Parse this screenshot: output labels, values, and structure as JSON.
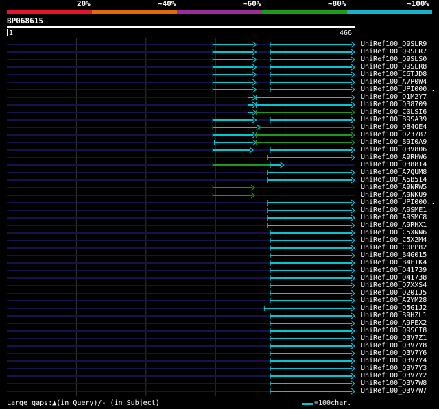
{
  "legend": {
    "colors": [
      "#e8142c",
      "#e06b0f",
      "#9b2e9b",
      "#1c9a1c",
      "#14b4c8"
    ],
    "labels": [
      "20%",
      "~40%",
      "~60%",
      "~80%",
      "~100%"
    ]
  },
  "query": {
    "name": "BP068615",
    "start": "1",
    "end": "466",
    "length": 466
  },
  "colors": {
    "background": "#000000",
    "track": "#14144b",
    "hit_cyan": "#00c8d2",
    "hit_green": "#1c9a1c",
    "grid": "#333333"
  },
  "hits": [
    {
      "name": "UniRef100_Q9SLR9",
      "segments": [
        {
          "start": 276,
          "end": 334,
          "color": "cyan"
        },
        {
          "start": 353,
          "end": 466,
          "color": "cyan"
        }
      ]
    },
    {
      "name": "UniRef100_Q9SLR7",
      "segments": [
        {
          "start": 276,
          "end": 334,
          "color": "cyan"
        },
        {
          "start": 353,
          "end": 466,
          "color": "cyan"
        }
      ]
    },
    {
      "name": "UniRef100_Q9SLS0",
      "segments": [
        {
          "start": 276,
          "end": 334,
          "color": "cyan"
        },
        {
          "start": 353,
          "end": 466,
          "color": "cyan"
        }
      ]
    },
    {
      "name": "UniRef100_Q9SLR8",
      "segments": [
        {
          "start": 276,
          "end": 334,
          "color": "cyan"
        },
        {
          "start": 353,
          "end": 466,
          "color": "cyan"
        }
      ]
    },
    {
      "name": "UniRef100_C6TJD8",
      "segments": [
        {
          "start": 276,
          "end": 334,
          "color": "cyan"
        },
        {
          "start": 353,
          "end": 466,
          "color": "cyan"
        }
      ]
    },
    {
      "name": "UniRef100_A7P0W4",
      "segments": [
        {
          "start": 276,
          "end": 334,
          "color": "cyan"
        },
        {
          "start": 353,
          "end": 466,
          "color": "cyan"
        }
      ]
    },
    {
      "name": "UniRef100_UPI000..",
      "segments": [
        {
          "start": 276,
          "end": 334,
          "color": "cyan"
        },
        {
          "start": 353,
          "end": 466,
          "color": "cyan"
        }
      ]
    },
    {
      "name": "UniRef100_Q1M2Y7",
      "segments": [
        {
          "start": 323,
          "end": 334,
          "color": "cyan"
        },
        {
          "start": 334,
          "end": 466,
          "color": "cyan"
        }
      ]
    },
    {
      "name": "UniRef100_Q38709",
      "segments": [
        {
          "start": 323,
          "end": 334,
          "color": "cyan"
        },
        {
          "start": 334,
          "end": 466,
          "color": "cyan"
        }
      ]
    },
    {
      "name": "UniRef100_C0LSI6",
      "segments": [
        {
          "start": 323,
          "end": 334,
          "color": "cyan"
        },
        {
          "start": 334,
          "end": 466,
          "color": "green"
        }
      ]
    },
    {
      "name": "UniRef100_B9SA39",
      "segments": [
        {
          "start": 276,
          "end": 334,
          "color": "cyan"
        },
        {
          "start": 353,
          "end": 466,
          "color": "cyan"
        }
      ]
    },
    {
      "name": "UniRef100_Q84QE4",
      "segments": [
        {
          "start": 276,
          "end": 339,
          "color": "cyan"
        },
        {
          "start": 339,
          "end": 466,
          "color": "green"
        }
      ]
    },
    {
      "name": "UniRef100_O23787",
      "segments": [
        {
          "start": 276,
          "end": 334,
          "color": "cyan"
        },
        {
          "start": 334,
          "end": 466,
          "color": "green"
        }
      ]
    },
    {
      "name": "UniRef100_B9I0A9",
      "segments": [
        {
          "start": 278,
          "end": 334,
          "color": "cyan"
        },
        {
          "start": 334,
          "end": 466,
          "color": "green"
        }
      ]
    },
    {
      "name": "UniRef100_Q3V806",
      "segments": [
        {
          "start": 276,
          "end": 330,
          "color": "cyan"
        },
        {
          "start": 353,
          "end": 466,
          "color": "cyan"
        }
      ]
    },
    {
      "name": "UniRef100_A9RHW6",
      "segments": [
        {
          "start": 349,
          "end": 466,
          "color": "cyan"
        }
      ]
    },
    {
      "name": "UniRef100_Q38814",
      "segments": [
        {
          "start": 276,
          "end": 371,
          "color": "green"
        },
        {
          "start": 353,
          "end": 371,
          "color": "cyan"
        }
      ]
    },
    {
      "name": "UniRef100_A7QUM8",
      "segments": [
        {
          "start": 349,
          "end": 466,
          "color": "cyan"
        }
      ]
    },
    {
      "name": "UniRef100_A5B514",
      "segments": [
        {
          "start": 349,
          "end": 466,
          "color": "cyan"
        }
      ]
    },
    {
      "name": "UniRef100_A9NRW5",
      "segments": [
        {
          "start": 276,
          "end": 332,
          "color": "green"
        }
      ]
    },
    {
      "name": "UniRef100_A9NKU9",
      "segments": [
        {
          "start": 276,
          "end": 332,
          "color": "green"
        }
      ]
    },
    {
      "name": "UniRef100_UPI000..",
      "segments": [
        {
          "start": 349,
          "end": 466,
          "color": "cyan"
        }
      ]
    },
    {
      "name": "UniRef100_A9SME1",
      "segments": [
        {
          "start": 349,
          "end": 466,
          "color": "cyan"
        }
      ]
    },
    {
      "name": "UniRef100_A9SMC8",
      "segments": [
        {
          "start": 349,
          "end": 466,
          "color": "cyan"
        }
      ]
    },
    {
      "name": "UniRef100_A9RHX1",
      "segments": [
        {
          "start": 349,
          "end": 466,
          "color": "cyan"
        }
      ]
    },
    {
      "name": "UniRef100_C5XNN6",
      "segments": [
        {
          "start": 353,
          "end": 466,
          "color": "cyan"
        }
      ]
    },
    {
      "name": "UniRef100_C5X2M4",
      "segments": [
        {
          "start": 353,
          "end": 466,
          "color": "cyan"
        }
      ]
    },
    {
      "name": "UniRef100_C0PP82",
      "segments": [
        {
          "start": 353,
          "end": 466,
          "color": "cyan"
        }
      ]
    },
    {
      "name": "UniRef100_B4G015",
      "segments": [
        {
          "start": 353,
          "end": 466,
          "color": "cyan"
        }
      ]
    },
    {
      "name": "UniRef100_B4FTK4",
      "segments": [
        {
          "start": 353,
          "end": 466,
          "color": "cyan"
        }
      ]
    },
    {
      "name": "UniRef100_O41739",
      "segments": [
        {
          "start": 353,
          "end": 466,
          "color": "cyan"
        }
      ]
    },
    {
      "name": "UniRef100_O41738",
      "segments": [
        {
          "start": 353,
          "end": 466,
          "color": "cyan"
        }
      ]
    },
    {
      "name": "UniRef100_Q7XXS4",
      "segments": [
        {
          "start": 353,
          "end": 466,
          "color": "cyan"
        }
      ]
    },
    {
      "name": "UniRef100_Q20IJ5",
      "segments": [
        {
          "start": 353,
          "end": 466,
          "color": "cyan"
        }
      ]
    },
    {
      "name": "UniRef100_A2YM28",
      "segments": [
        {
          "start": 353,
          "end": 466,
          "color": "cyan"
        }
      ]
    },
    {
      "name": "UniRef100_Q5G1J2",
      "segments": [
        {
          "start": 345,
          "end": 466,
          "color": "cyan"
        }
      ]
    },
    {
      "name": "UniRef100_B9HZL1",
      "segments": [
        {
          "start": 353,
          "end": 466,
          "color": "cyan"
        }
      ]
    },
    {
      "name": "UniRef100_A9PEX2",
      "segments": [
        {
          "start": 353,
          "end": 466,
          "color": "cyan"
        }
      ]
    },
    {
      "name": "UniRef100_Q9SCI8",
      "segments": [
        {
          "start": 353,
          "end": 466,
          "color": "cyan"
        }
      ]
    },
    {
      "name": "UniRef100_Q3V7Z1",
      "segments": [
        {
          "start": 353,
          "end": 466,
          "color": "cyan"
        }
      ]
    },
    {
      "name": "UniRef100_Q3V7Y8",
      "segments": [
        {
          "start": 353,
          "end": 466,
          "color": "cyan"
        }
      ]
    },
    {
      "name": "UniRef100_Q3V7Y6",
      "segments": [
        {
          "start": 353,
          "end": 466,
          "color": "cyan"
        }
      ]
    },
    {
      "name": "UniRef100_Q3V7Y4",
      "segments": [
        {
          "start": 353,
          "end": 466,
          "color": "cyan"
        }
      ]
    },
    {
      "name": "UniRef100_Q3V7Y3",
      "segments": [
        {
          "start": 353,
          "end": 466,
          "color": "cyan"
        }
      ]
    },
    {
      "name": "UniRef100_Q3V7Y2",
      "segments": [
        {
          "start": 353,
          "end": 466,
          "color": "cyan"
        }
      ]
    },
    {
      "name": "UniRef100_Q3V7W8",
      "segments": [
        {
          "start": 353,
          "end": 466,
          "color": "cyan"
        }
      ]
    },
    {
      "name": "UniRef100_Q3V7W7",
      "segments": [
        {
          "start": 353,
          "end": 466,
          "color": "cyan"
        }
      ]
    }
  ],
  "footer": {
    "gaps_text": "Large gaps:▲(in Query)/- (in Subject)",
    "scale_text": "=100char."
  }
}
